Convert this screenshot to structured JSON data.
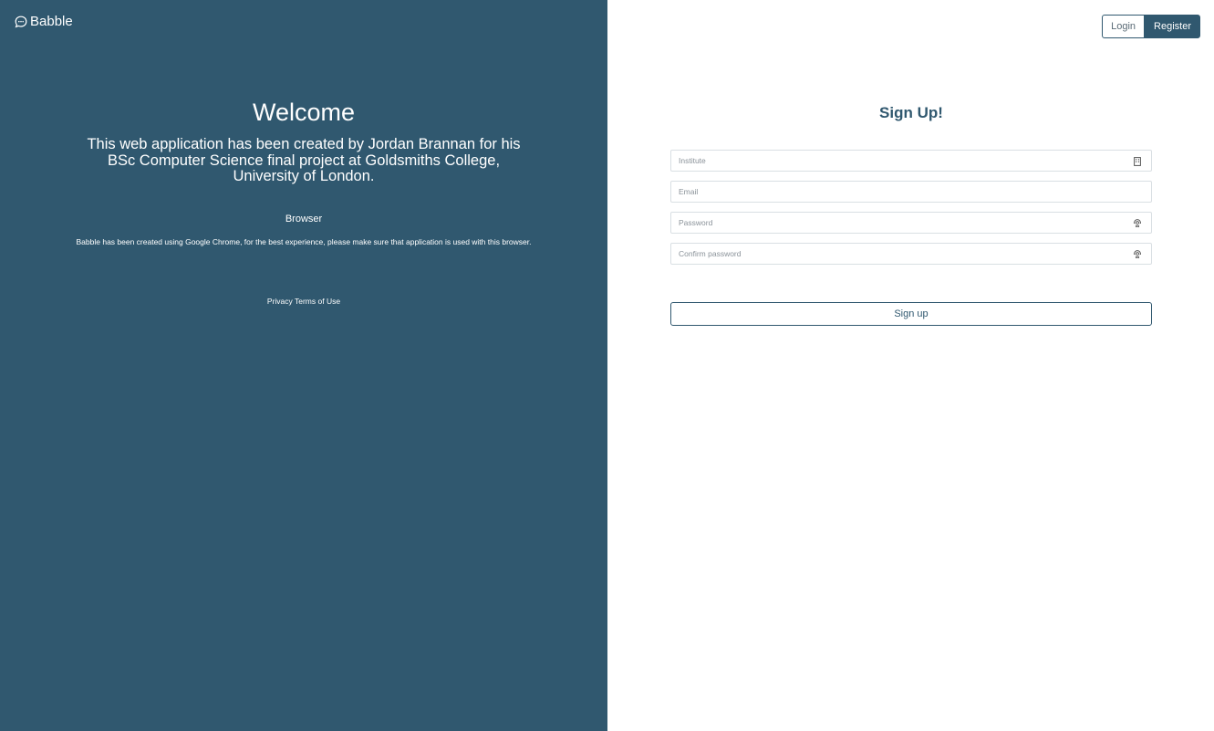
{
  "brand": {
    "name": "Babble",
    "icon": "chat-bubble-icon"
  },
  "nav": {
    "login_label": "Login",
    "register_label": "Register"
  },
  "left": {
    "title": "Welcome",
    "description": "This web application has been created by Jordan Brannan for his BSc Computer Science final project at Goldsmiths College, University of London.",
    "browser_heading": "Browser",
    "browser_text": "Babble has been created using Google Chrome, for the best experience, please make sure that application is used with this browser.",
    "footer": {
      "privacy": "Privacy",
      "terms": "Terms of Use"
    }
  },
  "form": {
    "title": "Sign Up!",
    "institute_placeholder": "Institute",
    "email_placeholder": "Email",
    "password_placeholder": "Password",
    "confirm_placeholder": "Confirm password",
    "submit_label": "Sign up"
  },
  "colors": {
    "primary": "#30586f",
    "input_border": "#d9dfe3",
    "placeholder": "#8a9299"
  }
}
